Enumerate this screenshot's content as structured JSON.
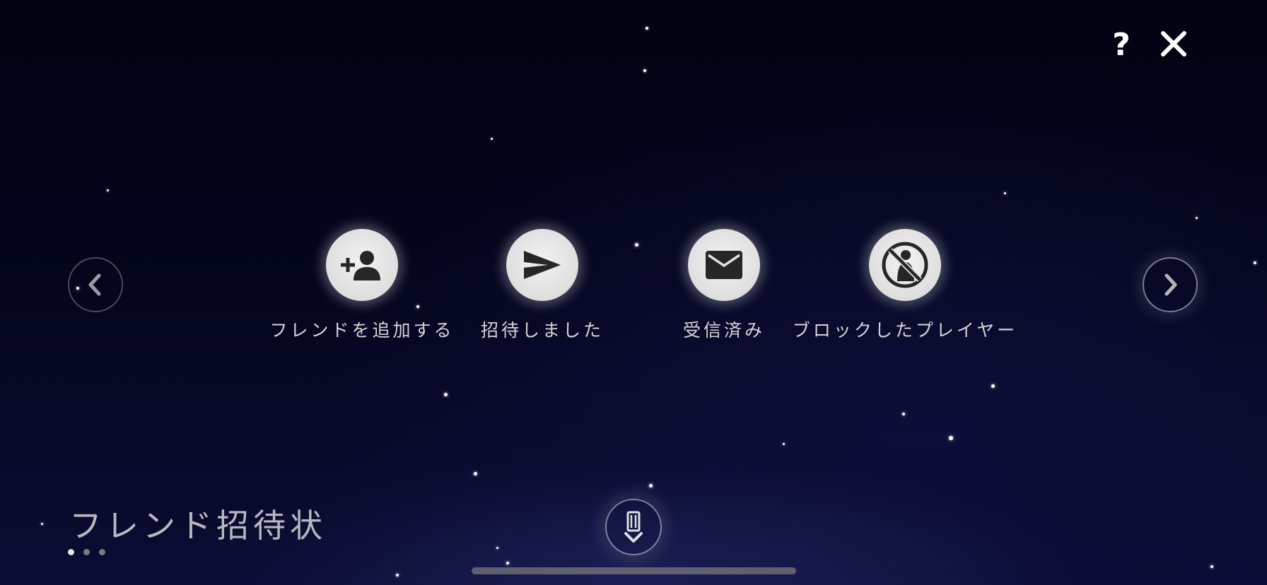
{
  "header": {
    "help_icon": "help-icon",
    "close_icon": "close-icon"
  },
  "carousel": {
    "prev_icon": "chevron-left-icon",
    "next_icon": "chevron-right-icon"
  },
  "friend_menu": {
    "items": [
      {
        "label": "フレンドを追加する",
        "icon": "add-person-icon"
      },
      {
        "label": "招待しました",
        "icon": "paper-plane-icon"
      },
      {
        "label": "受信済み",
        "icon": "envelope-icon"
      },
      {
        "label": "ブロックしたプレイヤー",
        "icon": "blocked-person-icon"
      }
    ]
  },
  "page": {
    "title": "フレンド招待状",
    "page_count": 3,
    "active_page": 1
  },
  "bottom": {
    "icon": "candle-down-icon"
  },
  "colors": {
    "background": "#03041a",
    "button_face": "#e4e4e4",
    "icon_dark": "#2a2a2a",
    "label_text": "#d4d4d8"
  }
}
